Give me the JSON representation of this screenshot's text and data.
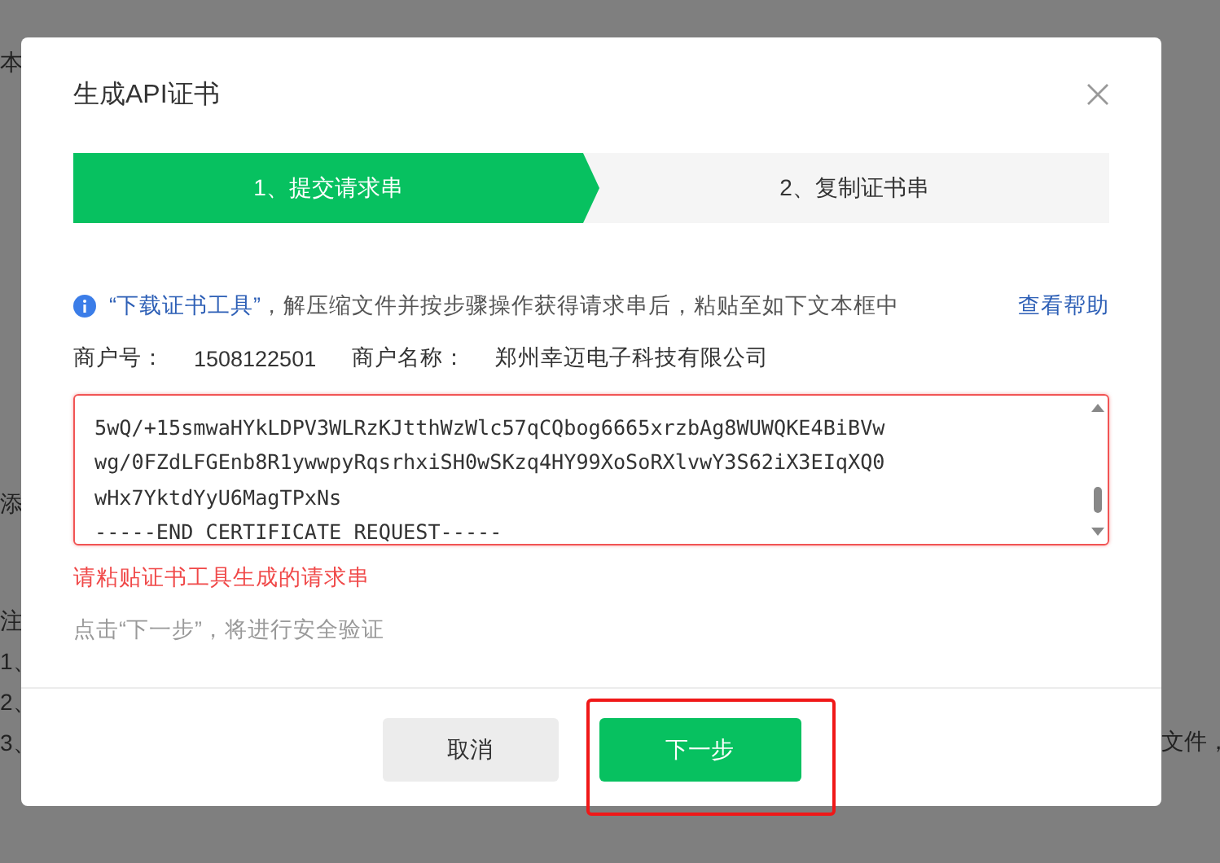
{
  "background": {
    "left_texts": [
      "本",
      "添",
      "注",
      "1、",
      "2、",
      "3、"
    ],
    "right_texts": [
      "文件，"
    ]
  },
  "dialog": {
    "title": "生成API证书",
    "steps": [
      {
        "label": "1、提交请求串",
        "selected": true
      },
      {
        "label": "2、复制证书串",
        "selected": false
      }
    ],
    "notice": {
      "link": "“下载证书工具”",
      "text": "，解压缩文件并按步骤操作获得请求串后，粘贴至如下文本框中",
      "help": "查看帮助"
    },
    "merchant": {
      "id_label": "商户号：",
      "id": "1508122501",
      "name_label": "商户名称：",
      "name": "郑州幸迈电子科技有限公司"
    },
    "request_field": {
      "error": true,
      "lines": [
        "5wQ/+15smwaHYkLDPV3WLRzKJtthWzWlc57qCQbog6665xrzbAg8WUWQKE4BiBVw",
        "wg/0FZdLFGEnb8R1ywwpyRqsrhxiSH0wSKzq4HY99XoSoRXlvwY3S62iX3EIqXQ0",
        "wHx7YktdYyU6MagTPxNs",
        "-----END CERTIFICATE REQUEST-----"
      ]
    },
    "error_message": "请粘贴证书工具生成的请求串",
    "hint": "点击“下一步”，将进行安全验证",
    "buttons": [
      {
        "label": "取消",
        "kind": "secondary",
        "highlighted": false
      },
      {
        "label": "下一步",
        "kind": "primary",
        "highlighted": true
      }
    ]
  }
}
